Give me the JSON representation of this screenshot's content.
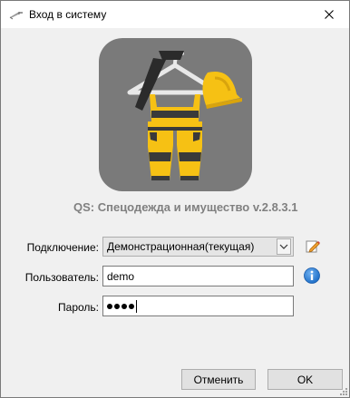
{
  "window": {
    "title": "Вход в систему",
    "close_icon": "close-icon",
    "title_icon": "key-icon"
  },
  "app": {
    "title": "QS: Спецодежда и имущество v.2.8.3.1",
    "logo_icon": "workwear-logo-icon"
  },
  "form": {
    "connection_label": "Подключение:",
    "connection_value": "Демонстрационная(текущая)",
    "user_label": "Пользователь:",
    "user_value": "demo",
    "password_label": "Пароль:",
    "password_length": 4
  },
  "buttons": {
    "cancel_label": "Отменить",
    "ok_label": "OK"
  },
  "colors": {
    "logo_background": "#7a7a7a",
    "workwear_yellow": "#f6c114",
    "app_title": "#808080",
    "info_blue": "#1e6fc8"
  }
}
